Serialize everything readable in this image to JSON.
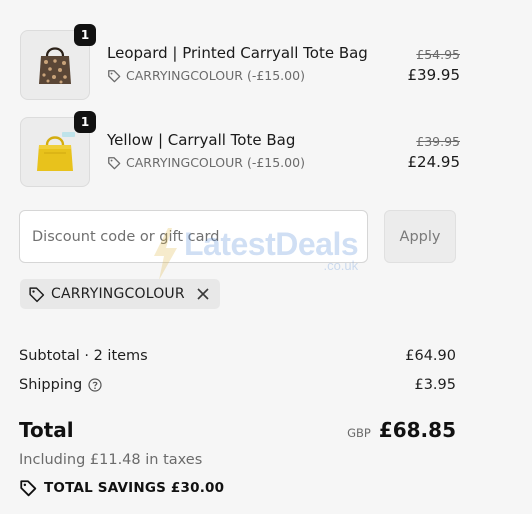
{
  "items": [
    {
      "quantity": "1",
      "title": "Leopard | Printed Carryall Tote Bag",
      "discount_text": "CARRYINGCOLOUR (-£15.00)",
      "original_price": "£54.95",
      "price": "£39.95",
      "image_icon": "leopard-tote-bag-image"
    },
    {
      "quantity": "1",
      "title": "Yellow | Carryall Tote Bag",
      "discount_text": "CARRYINGCOLOUR (-£15.00)",
      "original_price": "£39.95",
      "price": "£24.95",
      "image_icon": "yellow-tote-bag-image"
    }
  ],
  "discount": {
    "placeholder": "Discount code or gift card",
    "apply_label": "Apply",
    "applied_code": "CARRYINGCOLOUR"
  },
  "watermark": {
    "brand": "LatestDeals",
    "sub": ".co.uk"
  },
  "summary": {
    "subtotal_label": "Subtotal · 2 items",
    "subtotal_value": "£64.90",
    "shipping_label": "Shipping",
    "shipping_value": "£3.95",
    "total_label": "Total",
    "currency": "GBP",
    "total_value": "£68.85",
    "taxes_text": "Including £11.48 in taxes",
    "savings_text": "TOTAL SAVINGS £30.00"
  },
  "colors": {
    "background": "#f6f6f6",
    "leopard_bag": "#5a4636",
    "yellow_bag": "#e8c21c",
    "badge": "#111111",
    "watermark": "#5b8fd8"
  }
}
